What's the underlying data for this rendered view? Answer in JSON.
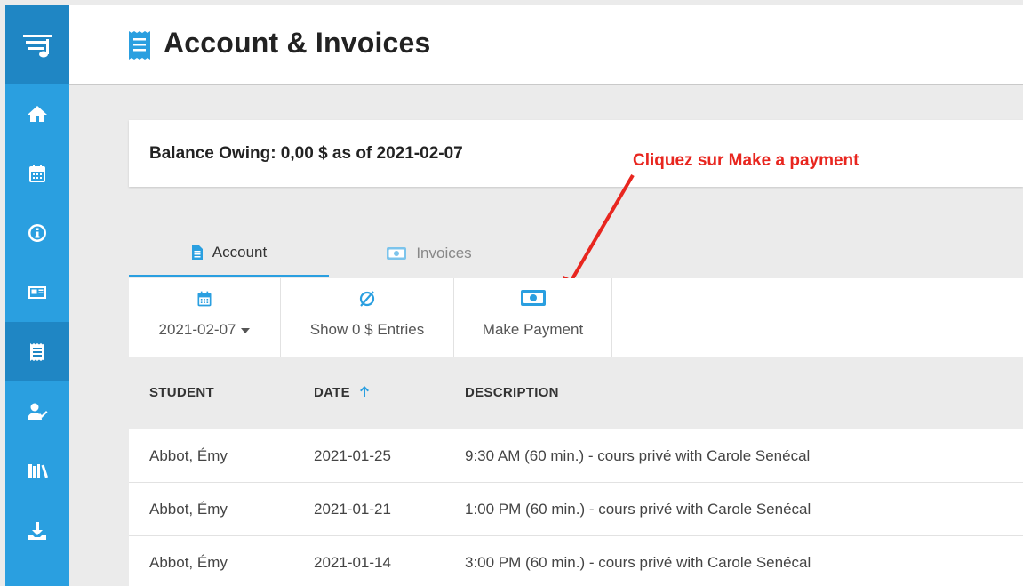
{
  "colors": {
    "accent": "#2a9fe0",
    "sidebar_active": "#1f86c4",
    "annotation": "#e8261f"
  },
  "sidebar": {
    "logo_icon": "music-list-icon",
    "items": [
      {
        "icon": "home-icon"
      },
      {
        "icon": "calendar-icon"
      },
      {
        "icon": "info-icon"
      },
      {
        "icon": "id-card-icon"
      },
      {
        "icon": "receipt-icon",
        "active": true
      },
      {
        "icon": "user-check-icon"
      },
      {
        "icon": "library-icon"
      },
      {
        "icon": "download-icon"
      }
    ]
  },
  "header": {
    "title": "Account & Invoices",
    "icon": "receipt-icon"
  },
  "balance": {
    "text": "Balance Owing:  0,00 $ as of 2021-02-07"
  },
  "annotation": {
    "text": "Cliquez sur Make a payment"
  },
  "tabs": [
    {
      "label": "Account",
      "icon": "document-icon",
      "active": true
    },
    {
      "label": "Invoices",
      "icon": "money-icon",
      "active": false
    }
  ],
  "toolbar": {
    "date_label": "2021-02-07",
    "zero_label": "Show 0 $ Entries",
    "payment_label": "Make Payment"
  },
  "table": {
    "headers": [
      "STUDENT",
      "DATE",
      "DESCRIPTION"
    ],
    "sort_icon": "arrow-up-icon",
    "rows": [
      {
        "student": "Abbot, Émy",
        "date": "2021-01-25",
        "description": "9:30 AM (60 min.) - cours privé with Carole Senécal"
      },
      {
        "student": "Abbot, Émy",
        "date": "2021-01-21",
        "description": "1:00 PM (60 min.) - cours privé with Carole Senécal"
      },
      {
        "student": "Abbot, Émy",
        "date": "2021-01-14",
        "description": "3:00 PM (60 min.) - cours privé with Carole Senécal"
      }
    ]
  }
}
